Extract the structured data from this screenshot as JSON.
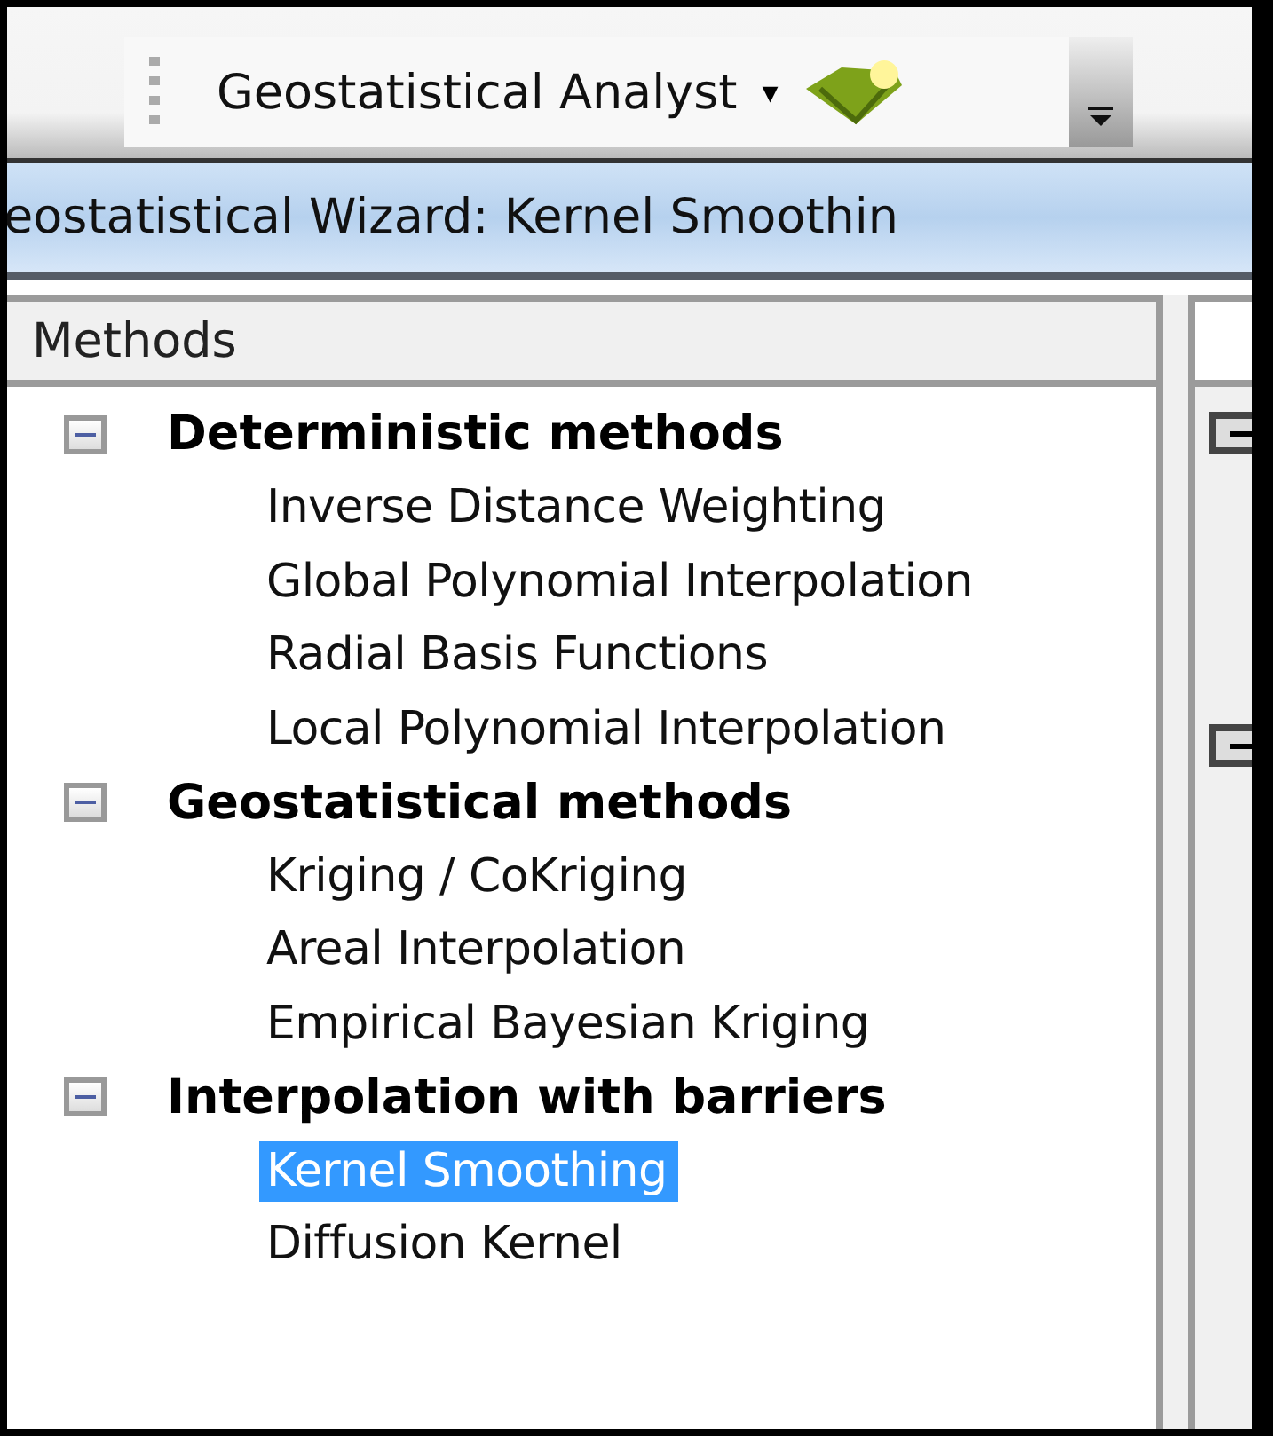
{
  "toolbar": {
    "title": "Geostatistical Analyst",
    "dropdown": "▾"
  },
  "wizard": {
    "title": "eostatistical Wizard: Kernel Smoothin"
  },
  "methods": {
    "header": "Methods",
    "groups": [
      {
        "label": "Deterministic methods",
        "expanded": true,
        "children": [
          {
            "label": "Inverse Distance Weighting",
            "selected": false
          },
          {
            "label": "Global Polynomial Interpolation",
            "selected": false
          },
          {
            "label": "Radial Basis Functions",
            "selected": false
          },
          {
            "label": "Local Polynomial Interpolation",
            "selected": false
          }
        ]
      },
      {
        "label": "Geostatistical methods",
        "expanded": true,
        "children": [
          {
            "label": "Kriging / CoKriging",
            "selected": false
          },
          {
            "label": "Areal Interpolation",
            "selected": false
          },
          {
            "label": "Empirical Bayesian Kriging",
            "selected": false
          }
        ]
      },
      {
        "label": "Interpolation with barriers",
        "expanded": true,
        "children": [
          {
            "label": "Kernel Smoothing",
            "selected": true
          },
          {
            "label": "Diffusion Kernel",
            "selected": false
          }
        ]
      }
    ]
  },
  "side_panel": {
    "groups": [
      {
        "expanded": true
      },
      {
        "expanded": true
      }
    ]
  }
}
